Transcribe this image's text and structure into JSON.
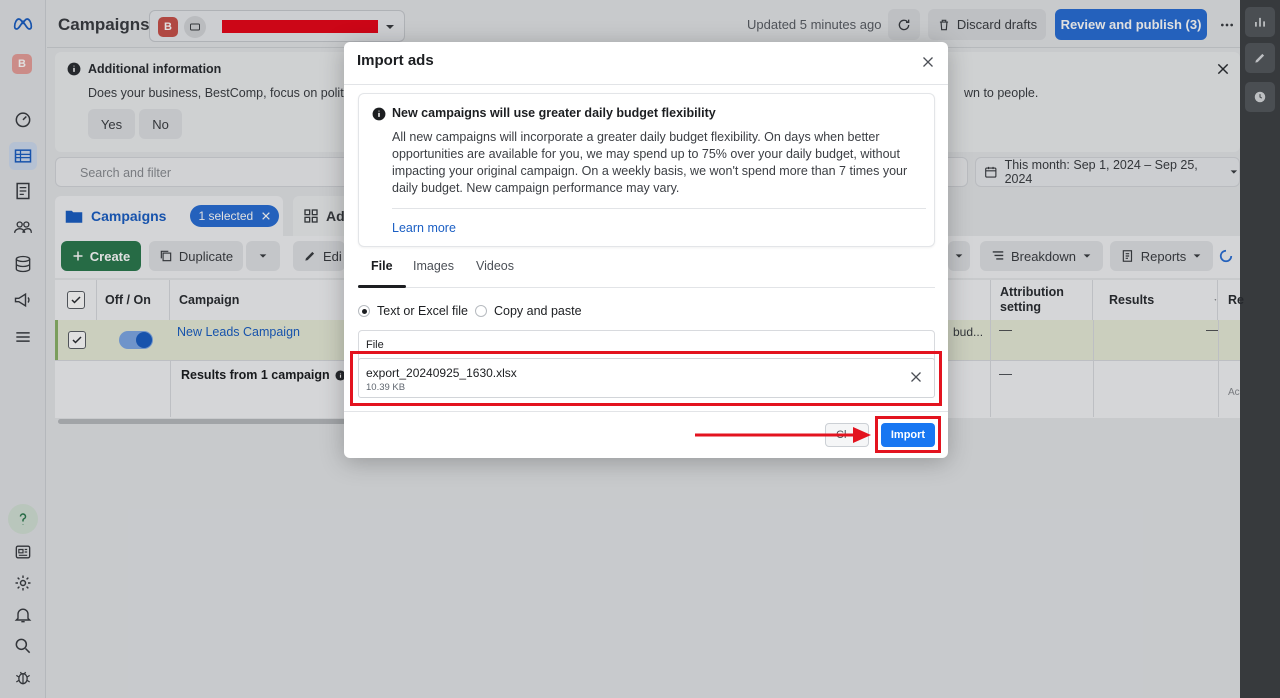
{
  "topbar": {
    "title": "Campaigns",
    "account_badge": "B",
    "updated": "Updated 5 minutes ago",
    "discard_label": "Discard drafts",
    "publish_label": "Review and publish (3)"
  },
  "sidebar": {
    "avatar": "B"
  },
  "banner": {
    "title": "Additional information",
    "text_start": "Does your business, BestComp, focus on politic",
    "text_end": "wn to people.",
    "yes_label": "Yes",
    "no_label": "No"
  },
  "search": {
    "placeholder": "Search and filter"
  },
  "date_range": "This month: Sep 1, 2024 – Sep 25, 2024",
  "tabs": {
    "campaigns_label": "Campaigns",
    "selected_label": "1 selected",
    "ads_label": "Ad"
  },
  "toolbar": {
    "create_label": "Create",
    "duplicate_label": "Duplicate",
    "edit_label": "Edi",
    "breakdown_label": "Breakdown",
    "reports_label": "Reports"
  },
  "table": {
    "headers": {
      "off_on": "Off / On",
      "campaign": "Campaign",
      "attribution": "Attribution setting",
      "results": "Results",
      "reach": "Re"
    },
    "row1": {
      "campaign_name": "New Leads Campaign",
      "budget_fragment": "bud...",
      "attribution": "—",
      "results": "—"
    },
    "row2": {
      "label": "Results from 1 campaign",
      "attribution": "—",
      "reach_fragment": "Ac"
    }
  },
  "modal": {
    "title": "Import ads",
    "info_title": "New campaigns will use greater daily budget flexibility",
    "info_body": "All new campaigns will incorporate a greater daily budget flexibility. On days when better opportunities are available for you, we may spend up to 75% over your daily budget, without impacting your original campaign. On a weekly basis, we won't spend more than 7 times your daily budget. New campaign performance may vary.",
    "learn_more": "Learn more",
    "tabs": [
      "File",
      "Images",
      "Videos"
    ],
    "radio_file": "Text or Excel file",
    "radio_paste": "Copy and paste",
    "file_label": "File",
    "file_name": "export_20240925_1630.xlsx",
    "file_size": "10.39 KB",
    "cancel_label": "Cl",
    "import_label": "Import"
  },
  "colors": {
    "accent": "#1877f2",
    "highlight": "#e3131f",
    "create_green": "#2c7a4f"
  }
}
